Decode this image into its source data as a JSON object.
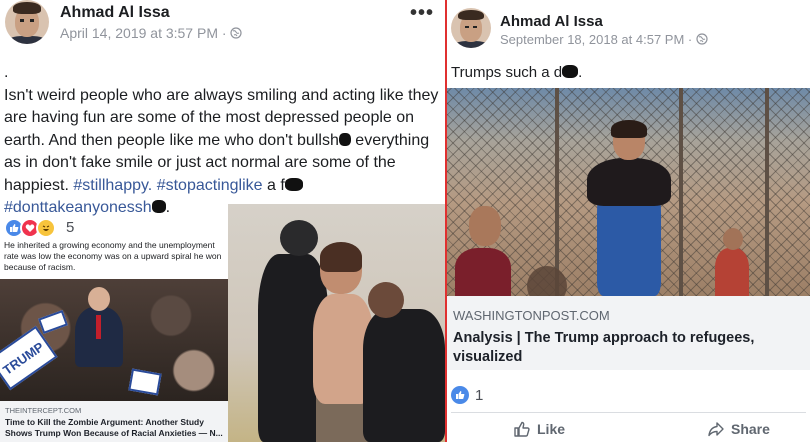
{
  "left_post": {
    "author": "Ahmad Al Issa",
    "timestamp": "April 14, 2019 at 3:57 PM",
    "privacy_icon": "globe-icon",
    "more_icon": "more-icon",
    "more_glyph": "•••",
    "body": {
      "dot": ".",
      "part1": "Isn't weird people who are always smiling and acting like they are having fun are some of the most depressed people on earth. And then people like me who don't bullsh",
      "part2": " everything as in don't fake smile or just act normal are some of the happiest. ",
      "hashtag1": "#stillhappy.",
      "hashtag2": "#stopactinglike",
      "part3": " a f",
      "hashtag3": "#donttakeanyonessh",
      "end": "."
    },
    "reactions": {
      "icons": [
        "like-icon",
        "love-icon",
        "haha-icon"
      ],
      "count": "5"
    },
    "caption": "He inherited a growing economy and the unemployment rate was low the economy was on a upward spiral he won because of racism.",
    "link": {
      "domain": "THEINTERCEPT.COM",
      "title": "Time to Kill the Zombie Argument: Another Study Shows Trump Won Because of Racial Anxieties — N...",
      "sign_text": "TRUMP"
    }
  },
  "right_post": {
    "author": "Ahmad Al Issa",
    "timestamp": "September 18, 2018 at 4:57 PM",
    "privacy_icon": "globe-icon",
    "text_before": "Trumps such a d",
    "text_after": ".",
    "link": {
      "domain": "WASHINGTONPOST.COM",
      "title": "Analysis | The Trump approach to refugees, visualized"
    },
    "like_count": "1",
    "actions": {
      "like": "Like",
      "share": "Share"
    }
  },
  "colors": {
    "hashtag": "#385898",
    "divider": "#e03030",
    "like_blue": "#4a89e8",
    "love_red": "#f0334e",
    "haha_yellow": "#f7c43c",
    "meta_gray": "#90949c",
    "link_bg": "#f2f3f5"
  }
}
